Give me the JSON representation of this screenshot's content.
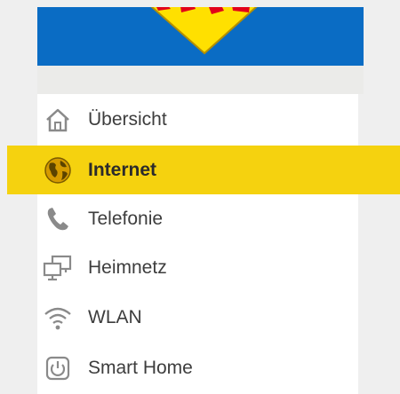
{
  "header": {
    "brand_logo": "fritz-logo",
    "brand_color": "#0a6cc4",
    "logo_colors": [
      "#e2001a",
      "#ffe000"
    ]
  },
  "menu": {
    "highlight_color": "#f5d20f",
    "items": [
      {
        "label": "Übersicht",
        "icon": "home-icon",
        "active": false
      },
      {
        "label": "Internet",
        "icon": "globe-icon",
        "active": true
      },
      {
        "label": "Telefonie",
        "icon": "phone-icon",
        "active": false
      },
      {
        "label": "Heimnetz",
        "icon": "network-icon",
        "active": false
      },
      {
        "label": "WLAN",
        "icon": "wifi-icon",
        "active": false
      },
      {
        "label": "Smart Home",
        "icon": "power-icon",
        "active": false
      }
    ]
  }
}
